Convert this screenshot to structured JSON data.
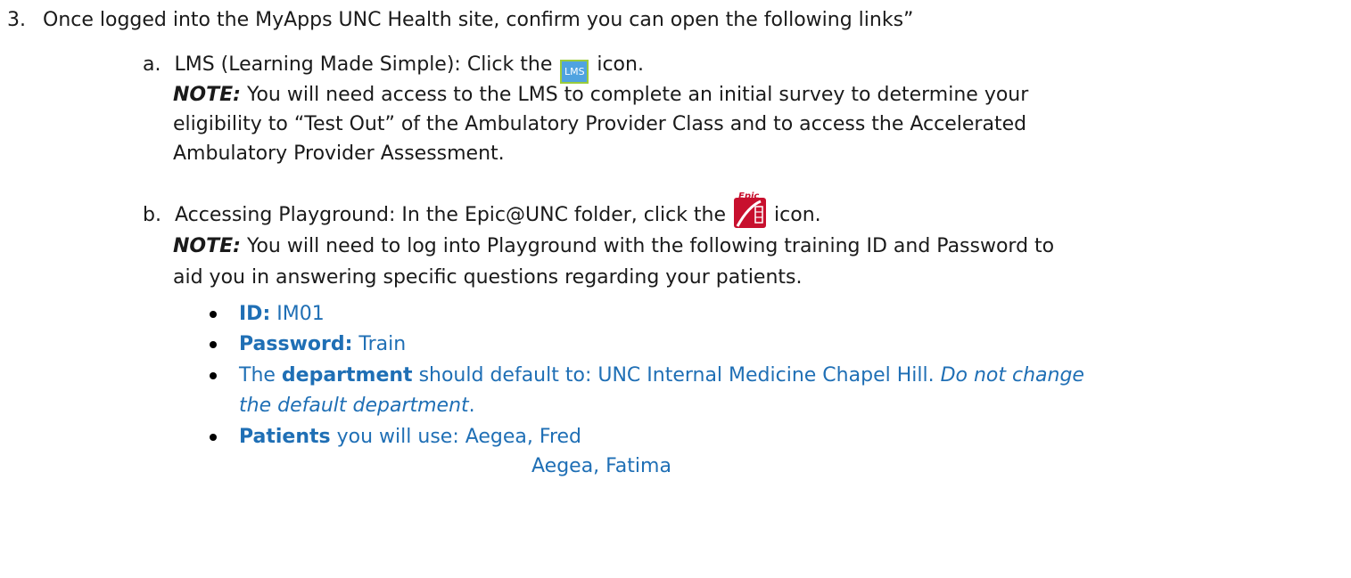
{
  "step3": {
    "number": "3.",
    "text": "Once logged into the MyApps UNC Health site, confirm you can open the following links”"
  },
  "item_a": {
    "letter": "a.",
    "before_icon": "LMS (Learning Made Simple): Click the ",
    "icon_label": "LMS",
    "after_icon": " icon.",
    "note_label": "NOTE:",
    "note_line1": " You will need access to the LMS to complete an initial survey to determine your",
    "note_line2": "eligibility to “Test Out” of the Ambulatory Provider Class and to access the Accelerated",
    "note_line3": "Ambulatory Provider Assessment."
  },
  "item_b": {
    "letter": "b.",
    "before_icon": "Accessing Playground: In the Epic@UNC folder, click the ",
    "after_icon": " icon.",
    "icon_label": "Epic",
    "note_label": "NOTE:",
    "note_line1": " You will need to log into Playground with the following training ID and Password to",
    "note_line2": "aid you in answering specific questions regarding your patients."
  },
  "bullets": {
    "id_label": "ID:",
    "id_value": " IM01",
    "password_label": "Password:",
    "password_value": " Train",
    "dept_prefix": "The ",
    "dept_label": "department",
    "dept_middle": " should default to: UNC Internal Medicine Chapel Hill. ",
    "dept_italic1": "Do not change",
    "dept_italic2": "the default department",
    "dept_end": ".",
    "patients_label": "Patients",
    "patients_middle": " you will use: Aegea, Fred",
    "patients_second": "Aegea, Fatima"
  }
}
